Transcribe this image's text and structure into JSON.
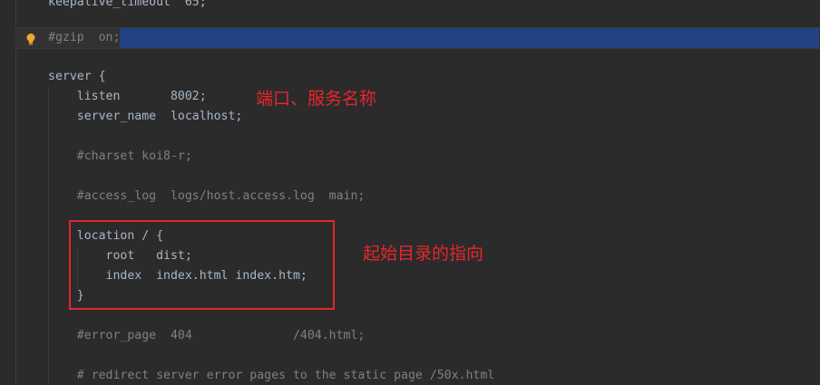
{
  "editor": {
    "lines": {
      "keepalive": "keepalive_timeout  65;",
      "gzip": "#gzip  on;",
      "server_open": "server {",
      "listen": "    listen       8002;",
      "server_name": "    server_name  localhost;",
      "charset": "    #charset koi8-r;",
      "access_log": "    #access_log  logs/host.access.log  main;",
      "location_open": "    location / {",
      "root": "        root   dist;",
      "index": "        index  index.html index.htm;",
      "location_close": "    }",
      "error_page": "    #error_page  404              /404.html;",
      "redirect_comment": "    # redirect server error pages to the static page /50x.html"
    },
    "colors": {
      "background": "#2b2b2b",
      "text": "#a9b7c6",
      "comment": "#808080",
      "selection": "#214283",
      "annotation": "#e8262c"
    },
    "gutter_icon": "lightbulb-icon"
  },
  "annotations": {
    "port_service_name": "端口、服务名称",
    "start_dir_pointer": "起始目录的指向"
  }
}
